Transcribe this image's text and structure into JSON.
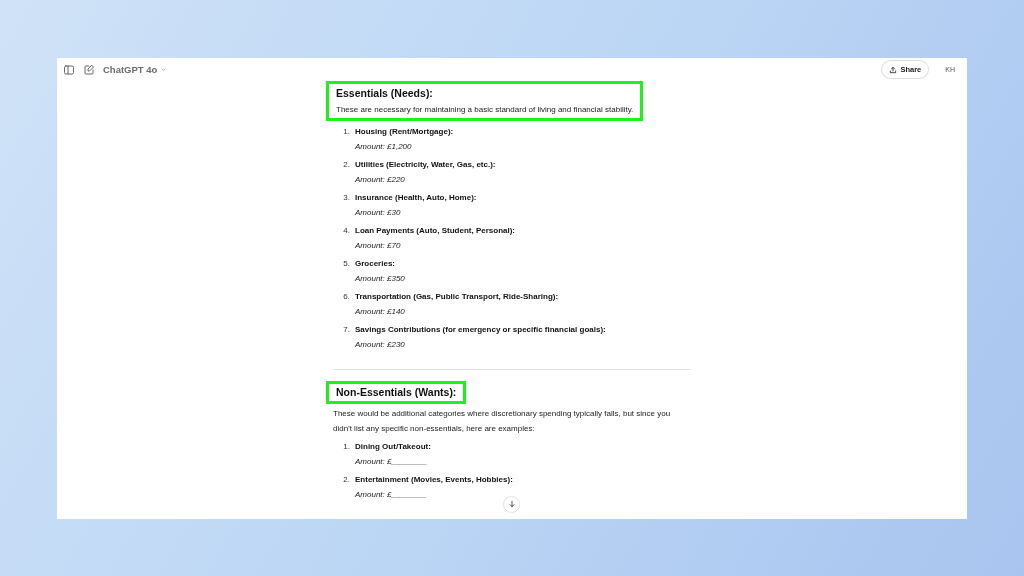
{
  "header": {
    "model": "ChatGPT 4o",
    "share": "Share",
    "initials": "KH"
  },
  "sections": [
    {
      "title": "Essentials (Needs):",
      "highlighted": true,
      "intro": "These are necessary for maintaining a basic standard of living and financial stability.",
      "items": [
        {
          "number": "1.",
          "label": "Housing (Rent/Mortgage):",
          "amount": "Amount: £1,200"
        },
        {
          "number": "2.",
          "label": "Utilities (Electricity, Water, Gas, etc.):",
          "amount": "Amount: £220"
        },
        {
          "number": "3.",
          "label": "Insurance (Health, Auto, Home):",
          "amount": "Amount: £30"
        },
        {
          "number": "4.",
          "label": "Loan Payments (Auto, Student, Personal):",
          "amount": "Amount: £70"
        },
        {
          "number": "5.",
          "label": "Groceries:",
          "amount": "Amount: £350"
        },
        {
          "number": "6.",
          "label": "Transportation (Gas, Public Transport, Ride-Sharing):",
          "amount": "Amount: £140"
        },
        {
          "number": "7.",
          "label": "Savings Contributions (for emergency or specific financial goals):",
          "amount": "Amount: £230"
        }
      ]
    },
    {
      "title": "Non-Essentials (Wants):",
      "highlighted": true,
      "intro": "These would be additional categories where discretionary spending typically falls, but since you didn't list any specific non-essentials, here are examples:",
      "items": [
        {
          "number": "1.",
          "label": "Dining Out/Takeout:",
          "amount": "Amount: £________"
        },
        {
          "number": "2.",
          "label": "Entertainment (Movies, Events, Hobbies):",
          "amount": "Amount: £________"
        }
      ]
    }
  ]
}
